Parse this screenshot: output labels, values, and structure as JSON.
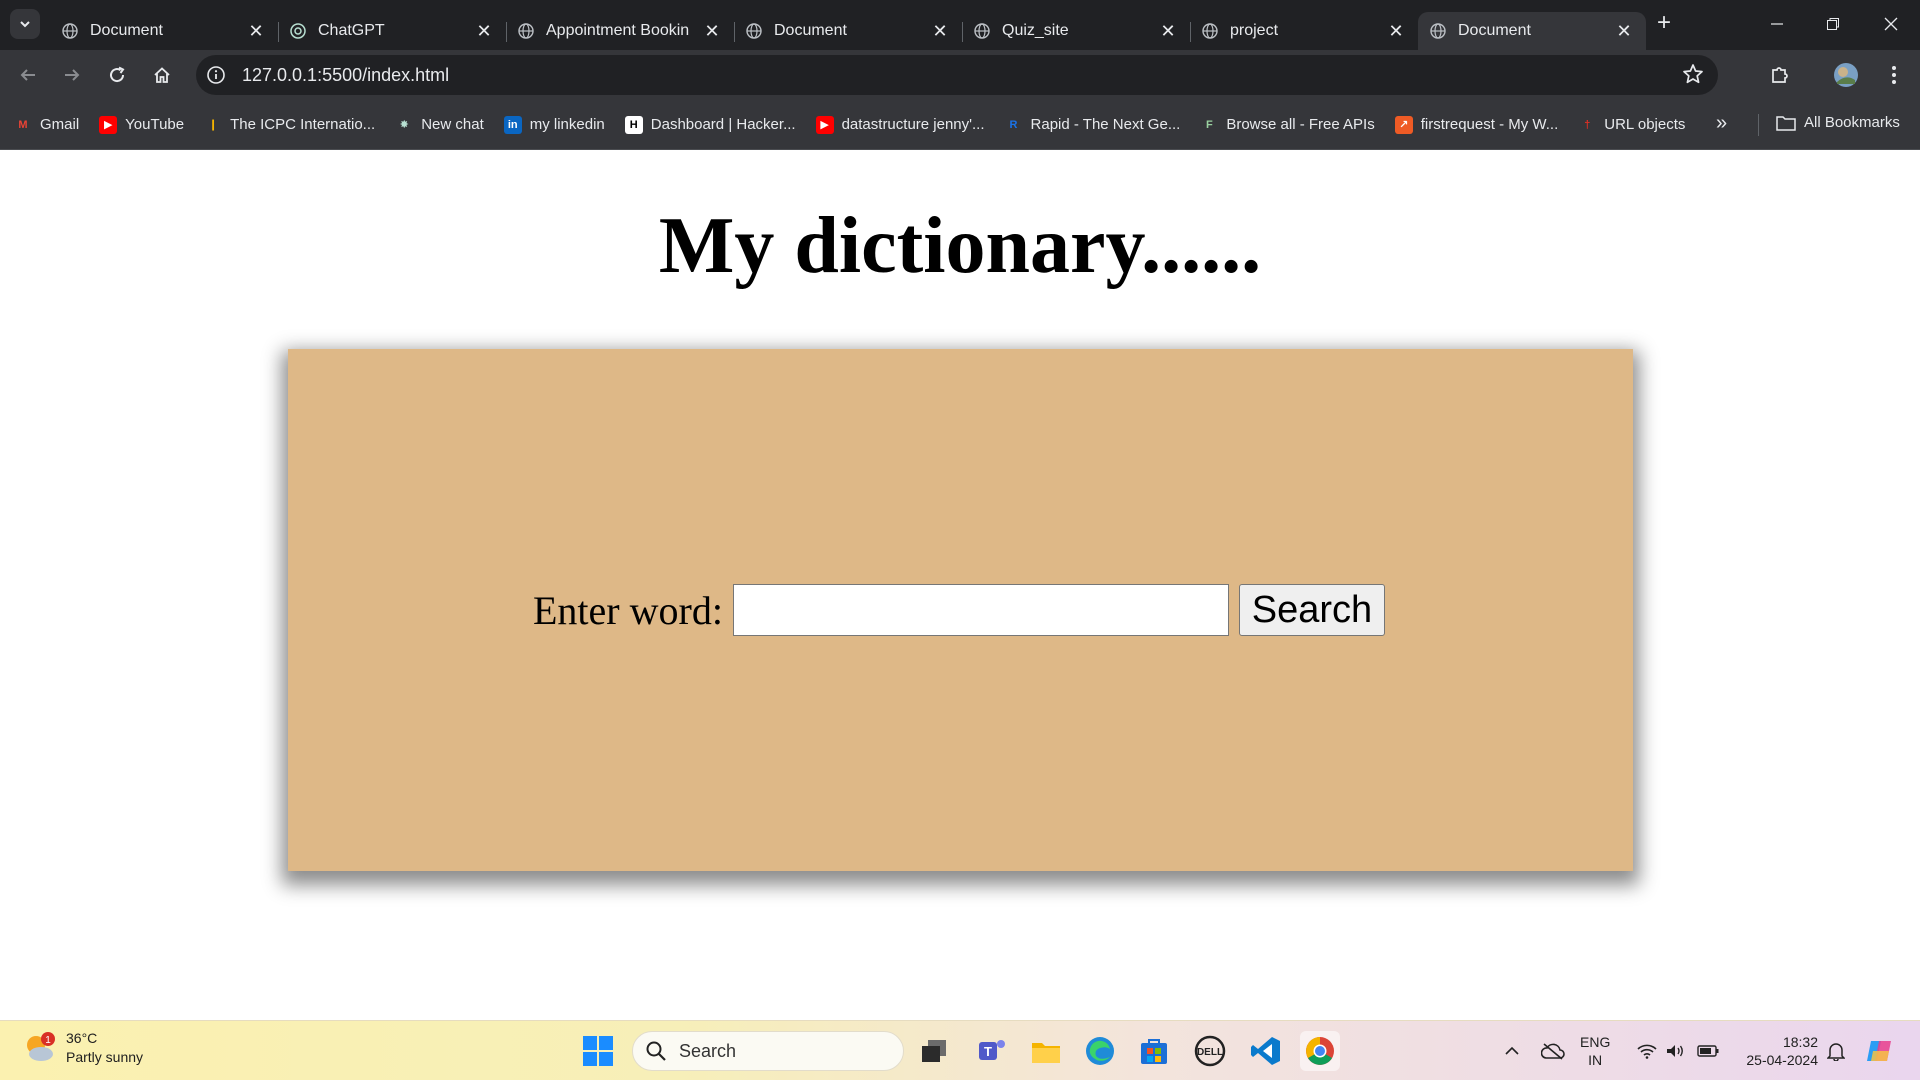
{
  "browser": {
    "tabs": [
      {
        "title": "Document",
        "favicon": "globe-icon",
        "active": false
      },
      {
        "title": "ChatGPT",
        "favicon": "chatgpt-icon",
        "active": false
      },
      {
        "title": "Appointment Bookin",
        "favicon": "globe-icon",
        "active": false
      },
      {
        "title": "Document",
        "favicon": "globe-icon",
        "active": false
      },
      {
        "title": "Quiz_site",
        "favicon": "globe-icon",
        "active": false
      },
      {
        "title": "project",
        "favicon": "globe-icon",
        "active": false
      },
      {
        "title": "Document",
        "favicon": "globe-icon",
        "active": true
      }
    ],
    "url": "127.0.0.1:5500/index.html",
    "bookmarks": [
      {
        "label": "Gmail",
        "icon": "gmail-icon"
      },
      {
        "label": "YouTube",
        "icon": "youtube-icon"
      },
      {
        "label": "The ICPC Internatio...",
        "icon": "icpc-icon"
      },
      {
        "label": "New chat",
        "icon": "chatgpt-icon"
      },
      {
        "label": "my linkedin",
        "icon": "linkedin-icon"
      },
      {
        "label": "Dashboard | Hacker...",
        "icon": "hackerrank-icon"
      },
      {
        "label": "datastructure jenny'...",
        "icon": "youtube-icon"
      },
      {
        "label": "Rapid - The Next Ge...",
        "icon": "rapid-icon"
      },
      {
        "label": "Browse all - Free APIs",
        "icon": "freeapis-icon"
      },
      {
        "label": "firstrequest - My W...",
        "icon": "postman-icon"
      },
      {
        "label": "URL objects",
        "icon": "mdn-icon"
      }
    ],
    "all_bookmarks_label": "All Bookmarks"
  },
  "page": {
    "title": "My dictionary......",
    "label": "Enter word:",
    "input_value": "",
    "search_button": "Search",
    "box_color": "#deb887"
  },
  "taskbar": {
    "weather_temp": "36°C",
    "weather_desc": "Partly sunny",
    "weather_badge": "1",
    "search_label": "Search",
    "lang_line1": "ENG",
    "lang_line2": "IN",
    "time": "18:32",
    "date": "25-04-2024"
  }
}
